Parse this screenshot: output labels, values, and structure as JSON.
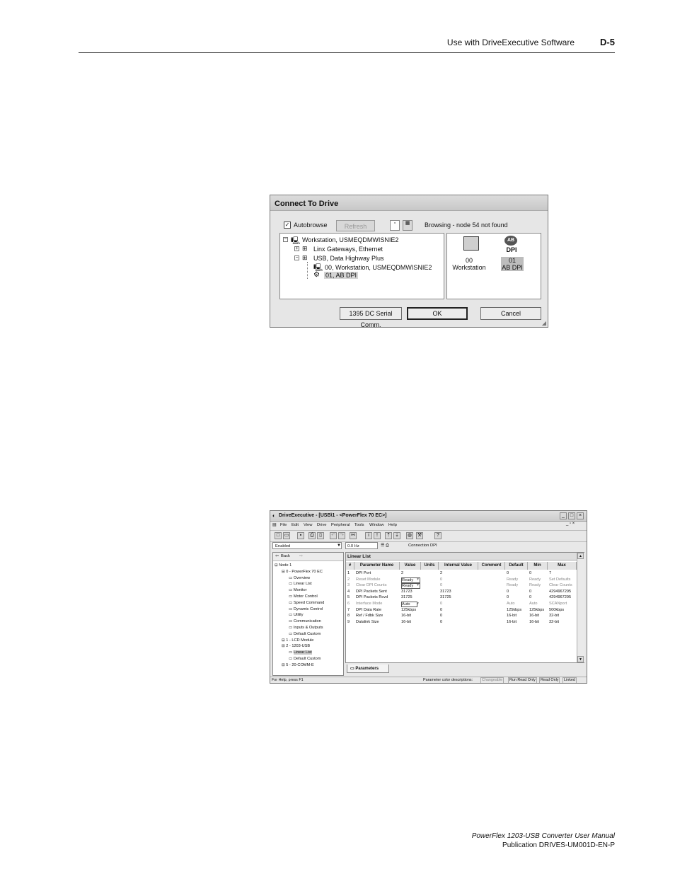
{
  "page_header": {
    "title": "Use with DriveExecutive Software",
    "page_number": "D-5"
  },
  "connect_dialog": {
    "title": "Connect To Drive",
    "autobrowse_label": "Autobrowse",
    "autobrowse_checked": true,
    "refresh_label": "Refresh",
    "status": "Browsing - node 54 not found",
    "tree": [
      "Workstation, USMEQDMWISNIE2",
      "Linx Gateways, Ethernet",
      "USB, Data Highway Plus",
      "00, Workstation, USMEQDMWISNIE2",
      "01, AB DPI"
    ],
    "devices": [
      {
        "line1": "00",
        "line2": "Workstation"
      },
      {
        "line1": "01",
        "line2": "AB DPI"
      }
    ],
    "dpi_badge": "DPI",
    "ab_logo": "AB",
    "buttons": {
      "serial": "1395 DC Serial Comm.",
      "ok": "OK",
      "cancel": "Cancel"
    }
  },
  "drive_exec": {
    "title": "DriveExecutive - [USB\\1 - <PowerFlex 70 EC>]",
    "menu": [
      "File",
      "Edit",
      "View",
      "Drive",
      "Peripheral",
      "Tools",
      "Window",
      "Help"
    ],
    "toolbar2": {
      "enabled": "Enabled",
      "hz": "0.0 Hz",
      "connection": "Connection DPI"
    },
    "nav": {
      "back": "Back",
      "forward": ""
    },
    "tree": [
      {
        "label": "Node 1",
        "level": 0
      },
      {
        "label": "0 - PowerFlex 70 EC",
        "level": 1
      },
      {
        "label": "Overview",
        "level": 2
      },
      {
        "label": "Linear List",
        "level": 2
      },
      {
        "label": "Monitor",
        "level": 2
      },
      {
        "label": "Motor Control",
        "level": 2
      },
      {
        "label": "Speed Command",
        "level": 2
      },
      {
        "label": "Dynamic Control",
        "level": 2
      },
      {
        "label": "Utility",
        "level": 2
      },
      {
        "label": "Communication",
        "level": 2
      },
      {
        "label": "Inputs & Outputs",
        "level": 2
      },
      {
        "label": "Default Custom",
        "level": 2
      },
      {
        "label": "1 - LCD Module",
        "level": 1
      },
      {
        "label": "2 - 1203-USB",
        "level": 1
      },
      {
        "label": "Linear List",
        "level": 2
      },
      {
        "label": "Default Custom",
        "level": 2
      },
      {
        "label": "5 - 20-COMM-E",
        "level": 1
      }
    ],
    "list_title": "Linear List",
    "columns": [
      "#",
      "Parameter Name",
      "Value",
      "Units",
      "Internal Value",
      "Comment",
      "Default",
      "Min",
      "Max"
    ],
    "rows": [
      {
        "n": "1",
        "name": "DPI Port",
        "value": "2",
        "units": "",
        "internal": "2",
        "default": "0",
        "min": "0",
        "max": "7",
        "gray": false,
        "dd": false
      },
      {
        "n": "2",
        "name": "Reset Module",
        "value": "Ready",
        "units": "",
        "internal": "0",
        "default": "Ready",
        "min": "Ready",
        "max": "Set Defaults",
        "gray": true,
        "dd": true
      },
      {
        "n": "3",
        "name": "Clear DPI Counts",
        "value": "Ready",
        "units": "",
        "internal": "0",
        "default": "Ready",
        "min": "Ready",
        "max": "Clear Counts",
        "gray": true,
        "dd": true
      },
      {
        "n": "4",
        "name": "DPI Packets Sent",
        "value": "31723",
        "units": "",
        "internal": "31723",
        "default": "0",
        "min": "0",
        "max": "4294967295",
        "gray": false,
        "dd": false
      },
      {
        "n": "5",
        "name": "DPI Packets Rcvd",
        "value": "31725",
        "units": "",
        "internal": "31725",
        "default": "0",
        "min": "0",
        "max": "4294967295",
        "gray": false,
        "dd": false
      },
      {
        "n": "6",
        "name": "Interface Mode",
        "value": "Auto",
        "units": "",
        "internal": "0",
        "default": "Auto",
        "min": "Auto",
        "max": "SCANport",
        "gray": true,
        "dd": true
      },
      {
        "n": "7",
        "name": "DPI Data Rate",
        "value": "125kbps",
        "units": "",
        "internal": "0",
        "default": "125kbps",
        "min": "125kbps",
        "max": "500kbps",
        "gray": false,
        "dd": false
      },
      {
        "n": "8",
        "name": "Ref / Fdbk Size",
        "value": "16-bit",
        "units": "",
        "internal": "0",
        "default": "16-bit",
        "min": "16-bit",
        "max": "32-bit",
        "gray": false,
        "dd": false
      },
      {
        "n": "9",
        "name": "Datalink Size",
        "value": "16-bit",
        "units": "",
        "internal": "0",
        "default": "16-bit",
        "min": "16-bit",
        "max": "32-bit",
        "gray": false,
        "dd": false
      }
    ],
    "tab_label": "Parameters",
    "status_left": "For Help, press F1",
    "status_right": [
      "Parameter color descriptions:",
      "Changeable",
      "Run Read Only",
      "Read Only",
      "Linked"
    ]
  },
  "footer": {
    "line1": "PowerFlex 1203-USB Converter User Manual",
    "line2": "Publication DRIVES-UM001D-EN-P"
  }
}
